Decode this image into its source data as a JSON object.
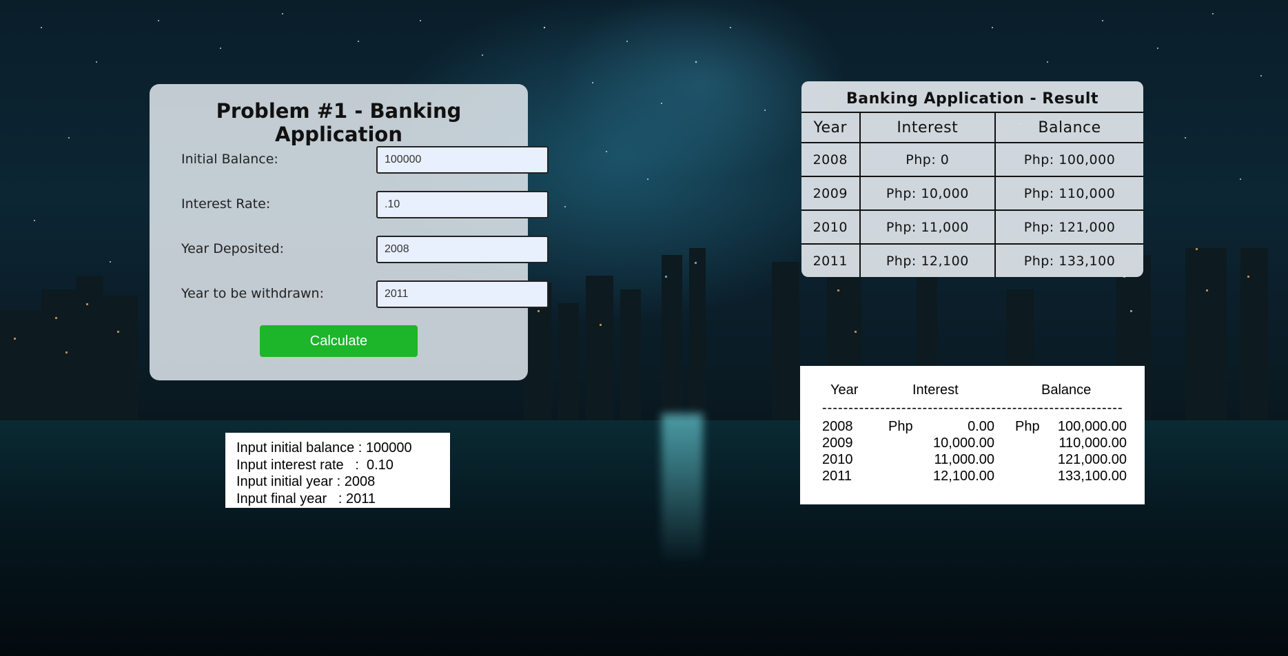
{
  "form": {
    "title": "Problem #1 - Banking Application",
    "fields": [
      {
        "label": "Initial Balance:",
        "value": "100000"
      },
      {
        "label": "Interest Rate:",
        "value": ".10"
      },
      {
        "label": "Year Deposited:",
        "value": "2008"
      },
      {
        "label": "Year to be withdrawn:",
        "value": "2011"
      }
    ],
    "button_label": "Calculate",
    "button_color": "#1db52a"
  },
  "result": {
    "title": "Banking Application - Result",
    "headers": [
      "Year",
      "Interest",
      "Balance"
    ],
    "rows": [
      [
        "2008",
        "Php: 0",
        "Php: 100,000"
      ],
      [
        "2009",
        "Php: 10,000",
        "Php: 110,000"
      ],
      [
        "2010",
        "Php: 11,000",
        "Php: 121,000"
      ],
      [
        "2011",
        "Php: 12,100",
        "Php: 133,100"
      ]
    ]
  },
  "console_input": {
    "lines": [
      "Input initial balance : 100000",
      "Input interest rate   :  0.10",
      "Input initial year : 2008",
      "Input final year   : 2011"
    ]
  },
  "console_output": {
    "headers": [
      "Year",
      "Interest",
      "Balance"
    ],
    "separator": "------------------------------------------------------------------------------",
    "rows": [
      {
        "year": "2008",
        "prefix": "Php",
        "interest": "0.00",
        "balance_prefix": "Php",
        "balance": "100,000.00"
      },
      {
        "year": "2009",
        "prefix": "",
        "interest": "10,000.00",
        "balance_prefix": "",
        "balance": "110,000.00"
      },
      {
        "year": "2010",
        "prefix": "",
        "interest": "11,000.00",
        "balance_prefix": "",
        "balance": "121,000.00"
      },
      {
        "year": "2011",
        "prefix": "",
        "interest": "12,100.00",
        "balance_prefix": "",
        "balance": "133,100.00"
      }
    ]
  }
}
